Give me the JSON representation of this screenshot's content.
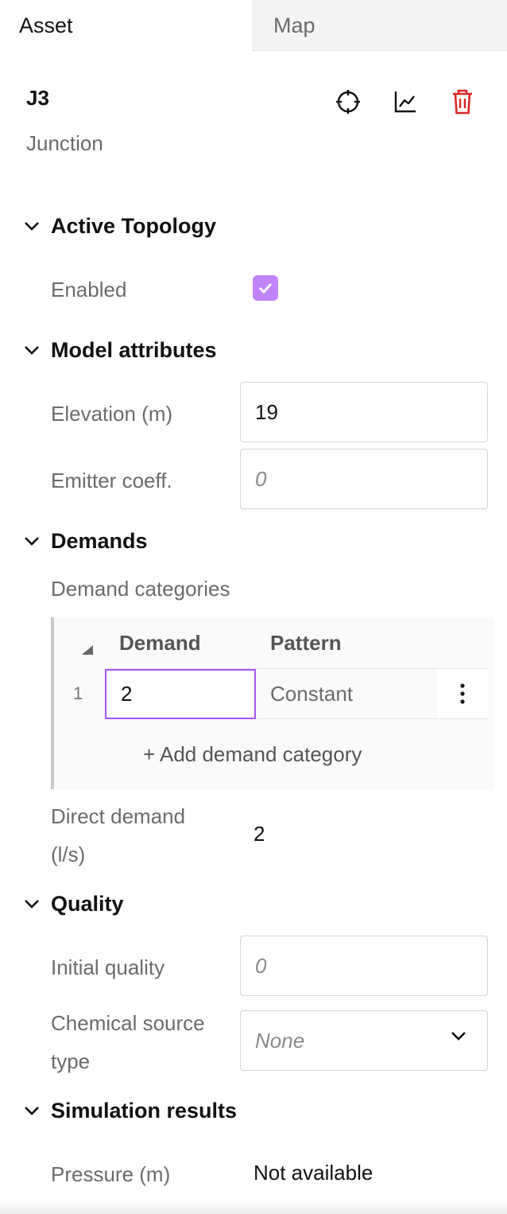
{
  "tabs": {
    "asset": "Asset",
    "map": "Map"
  },
  "asset": {
    "id": "J3",
    "type": "Junction"
  },
  "sections": {
    "active_topology": {
      "title": "Active Topology",
      "enabled_label": "Enabled",
      "enabled": true
    },
    "model_attributes": {
      "title": "Model attributes",
      "elevation_label": "Elevation (m)",
      "elevation_value": "19",
      "emitter_label": "Emitter coeff.",
      "emitter_placeholder": "0"
    },
    "demands": {
      "title": "Demands",
      "categories_label": "Demand categories",
      "columns": [
        "Demand",
        "Pattern"
      ],
      "rows": [
        {
          "index": "1",
          "demand": "2",
          "pattern": "Constant"
        }
      ],
      "add_label": "+ Add demand category",
      "direct_demand_label_line1": "Direct demand",
      "direct_demand_label_line2": "(l/s)",
      "direct_demand_value": "2"
    },
    "quality": {
      "title": "Quality",
      "initial_label": "Initial quality",
      "initial_placeholder": "0",
      "chem_label_line1": "Chemical source",
      "chem_label_line2": "type",
      "chem_value": "None"
    },
    "simulation": {
      "title": "Simulation results",
      "pressure_label": "Pressure (m)",
      "pressure_value": "Not available"
    }
  },
  "icons": {
    "locate": "crosshair-icon",
    "chart": "chart-icon",
    "delete": "trash-icon",
    "chevron": "chevron-down-icon"
  },
  "colors": {
    "accent": "#c084fc",
    "delete": "#dc2626",
    "focus": "#a855f7"
  }
}
